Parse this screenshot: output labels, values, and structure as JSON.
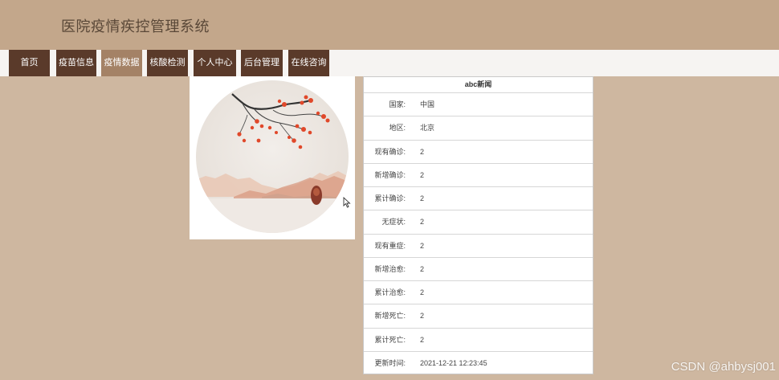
{
  "header": {
    "title": "医院疫情疾控管理系统"
  },
  "nav": {
    "items": [
      {
        "label": "首页",
        "active": false
      },
      {
        "label": "疫苗信息",
        "active": false
      },
      {
        "label": "疫情数据",
        "active": true
      },
      {
        "label": "核酸检测",
        "active": false
      },
      {
        "label": "个人中心",
        "active": false
      },
      {
        "label": "后台管理",
        "active": false
      },
      {
        "label": "在线咨询",
        "active": false
      }
    ]
  },
  "panel": {
    "title": "abc新闻",
    "rows": [
      {
        "label": "国家:",
        "value": "中国"
      },
      {
        "label": "地区:",
        "value": "北京"
      },
      {
        "label": "现有确诊:",
        "value": "2"
      },
      {
        "label": "新增确诊:",
        "value": "2"
      },
      {
        "label": "累计确诊:",
        "value": "2"
      },
      {
        "label": "无症状:",
        "value": "2"
      },
      {
        "label": "现有重症:",
        "value": "2"
      },
      {
        "label": "新增治愈:",
        "value": "2"
      },
      {
        "label": "累计治愈:",
        "value": "2"
      },
      {
        "label": "新增死亡:",
        "value": "2"
      },
      {
        "label": "累计死亡:",
        "value": "2"
      },
      {
        "label": "更新时间:",
        "value": "2021-12-21 12:23:45"
      }
    ]
  },
  "watermark": "CSDN @ahbysj001",
  "colors": {
    "background": "#ceb7a0",
    "header": "#c3a78b",
    "nav_item": "#5a3a2a",
    "nav_item_active": "#a48266",
    "leaf": "#e0482a"
  },
  "icons": {
    "cursor": "mouse-pointer-icon"
  }
}
